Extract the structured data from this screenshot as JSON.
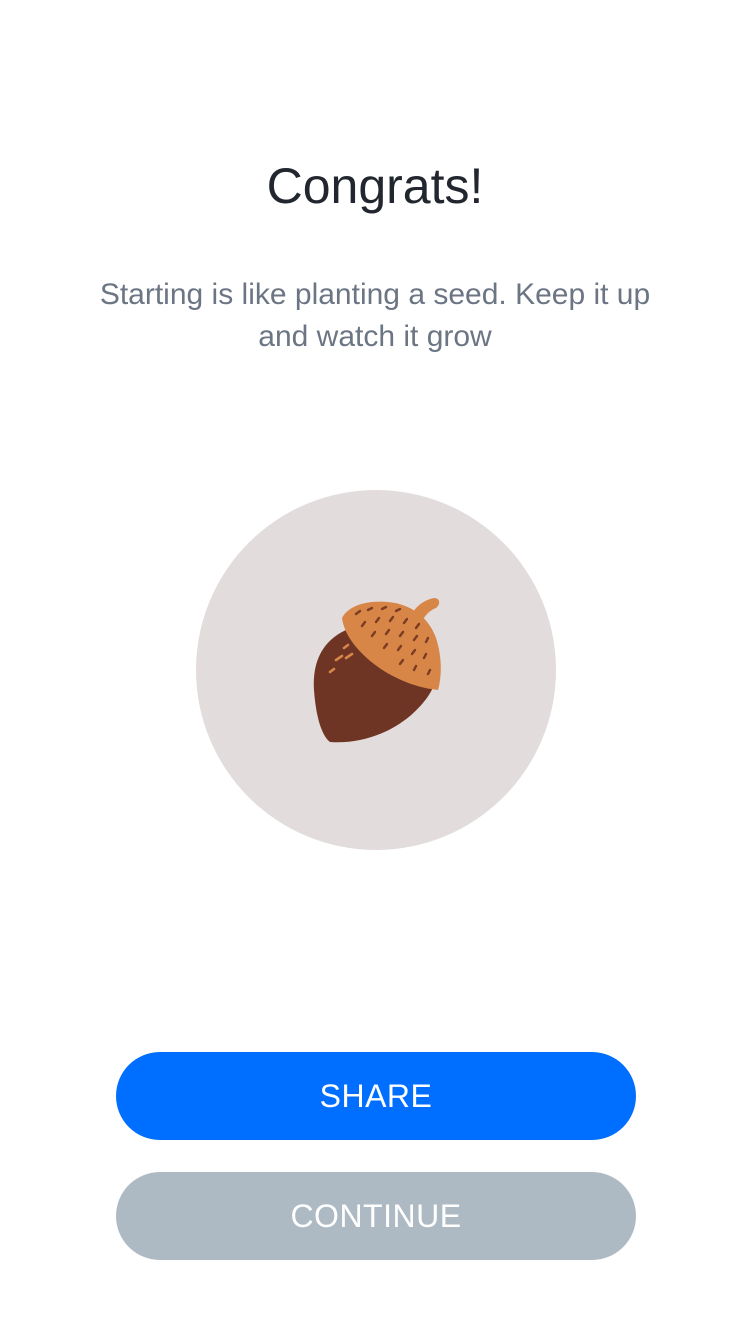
{
  "screen": {
    "title": "Congrats!",
    "subtitle": "Starting is like planting a seed. Keep it up and watch it grow"
  },
  "illustration": {
    "icon": "acorn-icon",
    "background_color": "#e2dcdc"
  },
  "actions": {
    "share_label": "SHARE",
    "continue_label": "CONTINUE"
  },
  "colors": {
    "primary": "#006eff",
    "secondary": "#aebac3",
    "title_text": "#22262e",
    "body_text": "#6b7583",
    "acorn_cap": "#d88648",
    "acorn_nut": "#6e3524"
  }
}
